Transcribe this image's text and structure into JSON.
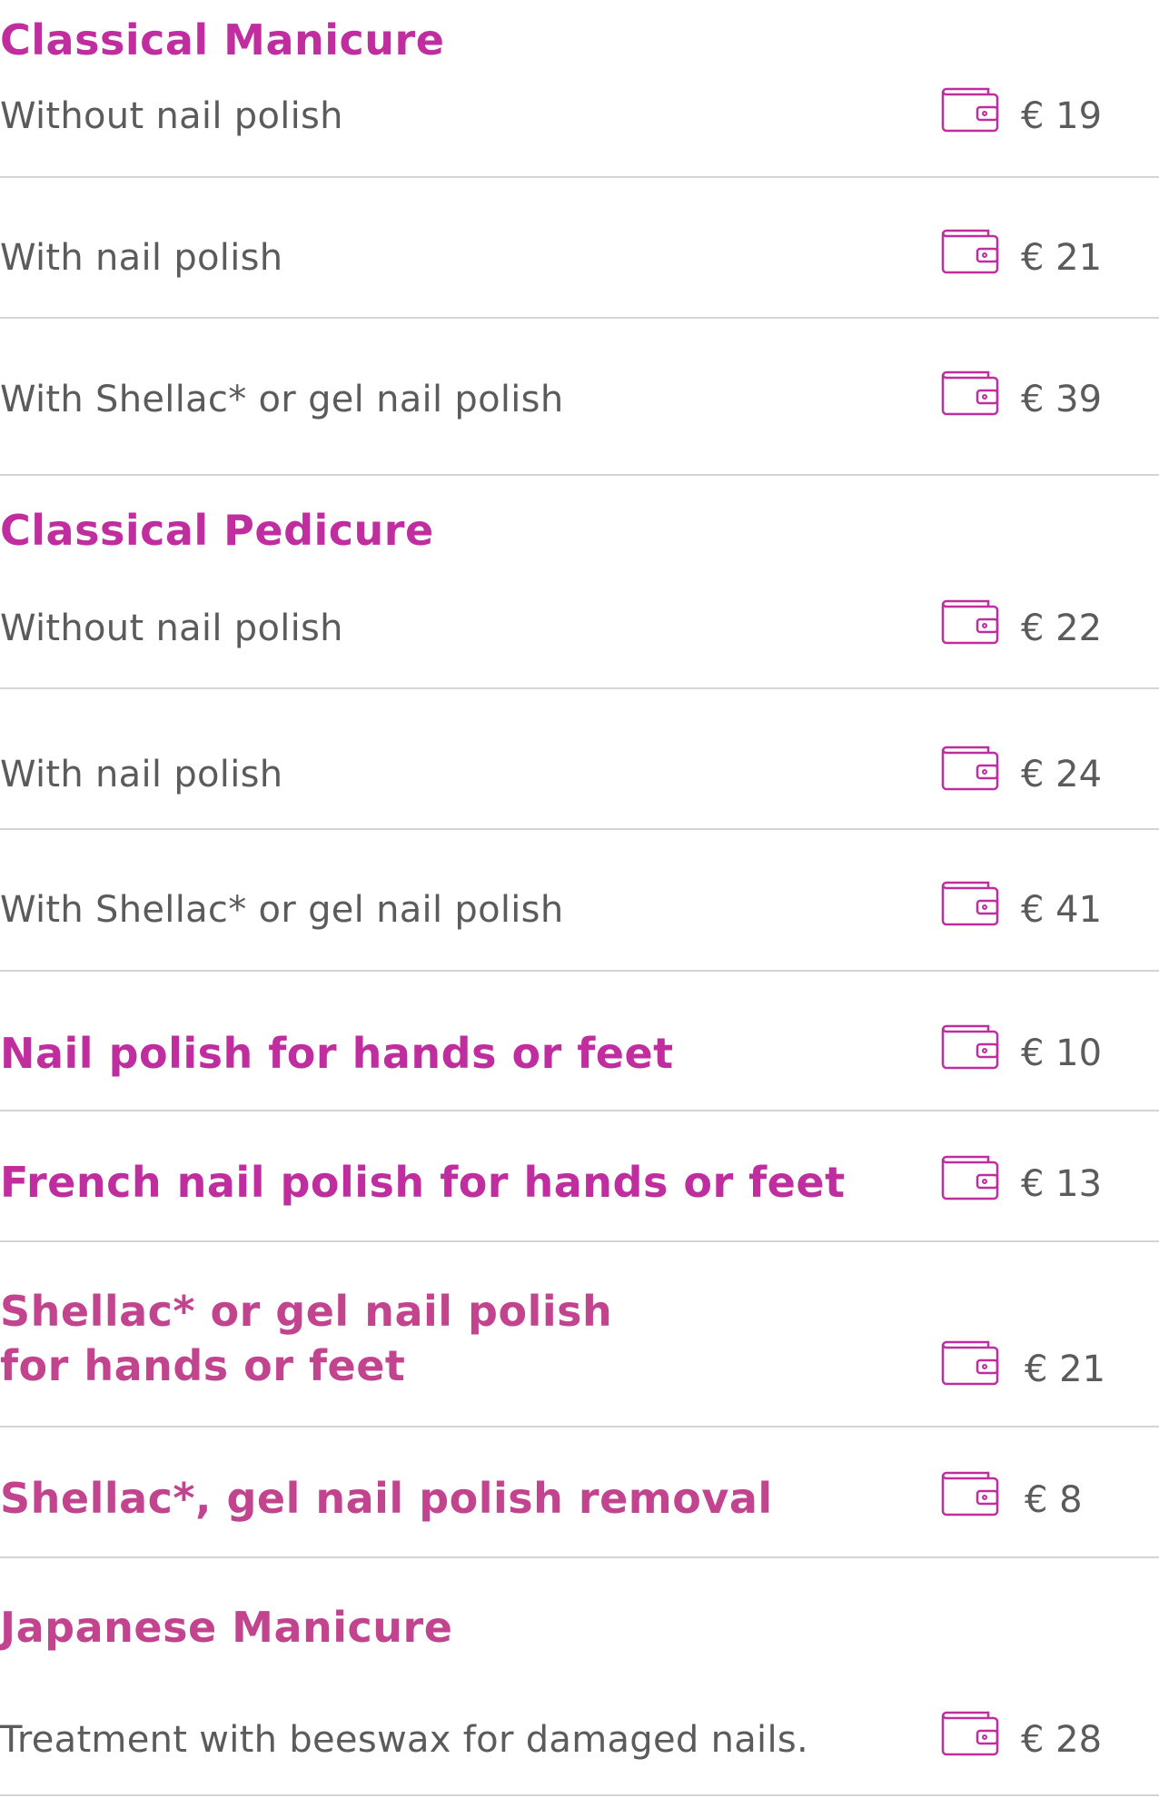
{
  "currency_symbol": "€",
  "accent_color": "#c02d9e",
  "sections": [
    {
      "title": "Classical Manicure",
      "items": [
        {
          "label": "Without nail polish",
          "price": "€ 19"
        },
        {
          "label": "With nail polish",
          "price": "€ 21"
        },
        {
          "label": "With Shellac* or gel nail polish",
          "price": "€ 39"
        }
      ]
    },
    {
      "title": "Classical Pedicure",
      "items": [
        {
          "label": "Without nail polish",
          "price": "€ 22"
        },
        {
          "label": "With nail polish",
          "price": "€ 24"
        },
        {
          "label": "With Shellac* or gel nail polish",
          "price": "€ 41"
        }
      ]
    }
  ],
  "single_services": [
    {
      "title": "Nail polish for hands or feet",
      "price": "€ 10"
    },
    {
      "title": "French nail polish for hands or feet",
      "price": "€ 13"
    },
    {
      "title": "Shellac* or gel nail polish\nfor hands or feet",
      "price": "€ 21"
    },
    {
      "title": "Shellac*, gel nail polish removal",
      "price": "€ 8"
    }
  ],
  "japanese": {
    "title": "Japanese Manicure",
    "items": [
      {
        "label": "Treatment with beeswax for damaged nails.",
        "price": "€ 28"
      }
    ]
  },
  "icon": "wallet-icon"
}
